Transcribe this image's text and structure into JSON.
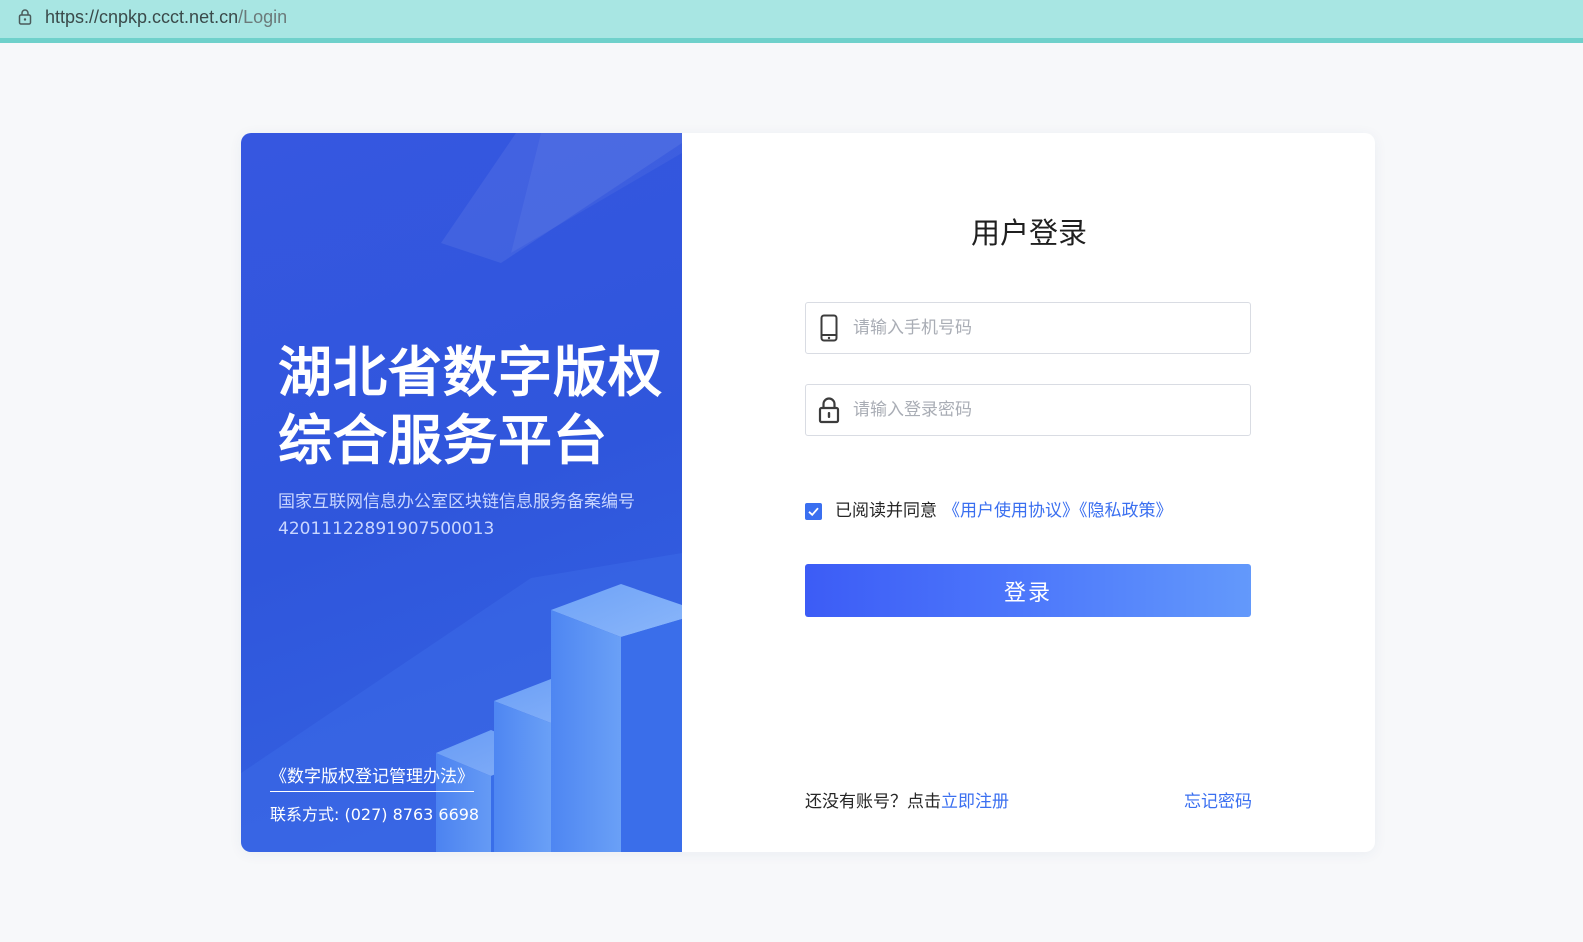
{
  "browser": {
    "url_host": "https://cnpkp.ccct.net.cn",
    "url_path": "/Login"
  },
  "left_panel": {
    "title_line1": "湖北省数字版权",
    "title_line2": "综合服务平台",
    "filing_label": "国家互联网信息办公室区块链信息服务备案编号",
    "filing_number": "42011122891907500013",
    "regulation_link": "《数字版权登记管理办法》",
    "contact": "联系方式: (027) 8763 6698"
  },
  "login_form": {
    "title": "用户登录",
    "phone_placeholder": "请输入手机号码",
    "password_placeholder": "请输入登录密码",
    "agree_text": "已阅读并同意",
    "agree_links": "《用户使用协议》《隐私政策》",
    "agree_checked": true,
    "submit_label": "登录",
    "no_account_text": "还没有账号？点击",
    "register_link": "立即注册",
    "forgot_link": "忘记密码"
  },
  "colors": {
    "accent": "#3a6ff0",
    "panel_blue": "#3259df",
    "address_bar": "#a8e6e3"
  }
}
